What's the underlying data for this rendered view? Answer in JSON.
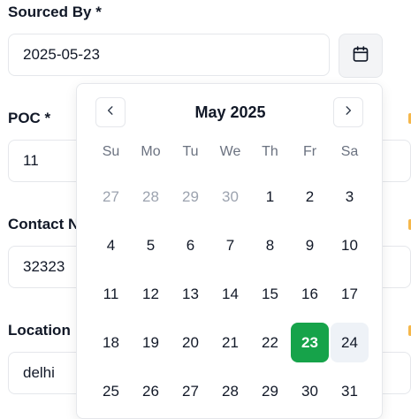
{
  "form": {
    "sourced_by": {
      "label": "Sourced By *",
      "value": "2025-05-23"
    },
    "poc": {
      "label": "POC *",
      "value": "11"
    },
    "contact": {
      "label": "Contact N",
      "value": "32323"
    },
    "location": {
      "label": "Location",
      "value": "delhi"
    }
  },
  "calendar": {
    "month_label": "May 2025",
    "weekdays": [
      "Su",
      "Mo",
      "Tu",
      "We",
      "Th",
      "Fr",
      "Sa"
    ],
    "days": [
      {
        "d": "27",
        "muted": true
      },
      {
        "d": "28",
        "muted": true
      },
      {
        "d": "29",
        "muted": true
      },
      {
        "d": "30",
        "muted": true
      },
      {
        "d": "1"
      },
      {
        "d": "2"
      },
      {
        "d": "3"
      },
      {
        "d": "4"
      },
      {
        "d": "5"
      },
      {
        "d": "6"
      },
      {
        "d": "7"
      },
      {
        "d": "8"
      },
      {
        "d": "9"
      },
      {
        "d": "10"
      },
      {
        "d": "11"
      },
      {
        "d": "12"
      },
      {
        "d": "13"
      },
      {
        "d": "14"
      },
      {
        "d": "15"
      },
      {
        "d": "16"
      },
      {
        "d": "17"
      },
      {
        "d": "18"
      },
      {
        "d": "19"
      },
      {
        "d": "20"
      },
      {
        "d": "21"
      },
      {
        "d": "22"
      },
      {
        "d": "23",
        "selected": true
      },
      {
        "d": "24",
        "hover": true
      },
      {
        "d": "25"
      },
      {
        "d": "26"
      },
      {
        "d": "27"
      },
      {
        "d": "28"
      },
      {
        "d": "29"
      },
      {
        "d": "30"
      },
      {
        "d": "31"
      }
    ],
    "selected_color": "#16a34a"
  },
  "icons": {
    "calendar_button": "calendar-icon",
    "prev": "chevron-left-icon",
    "next": "chevron-right-icon"
  }
}
